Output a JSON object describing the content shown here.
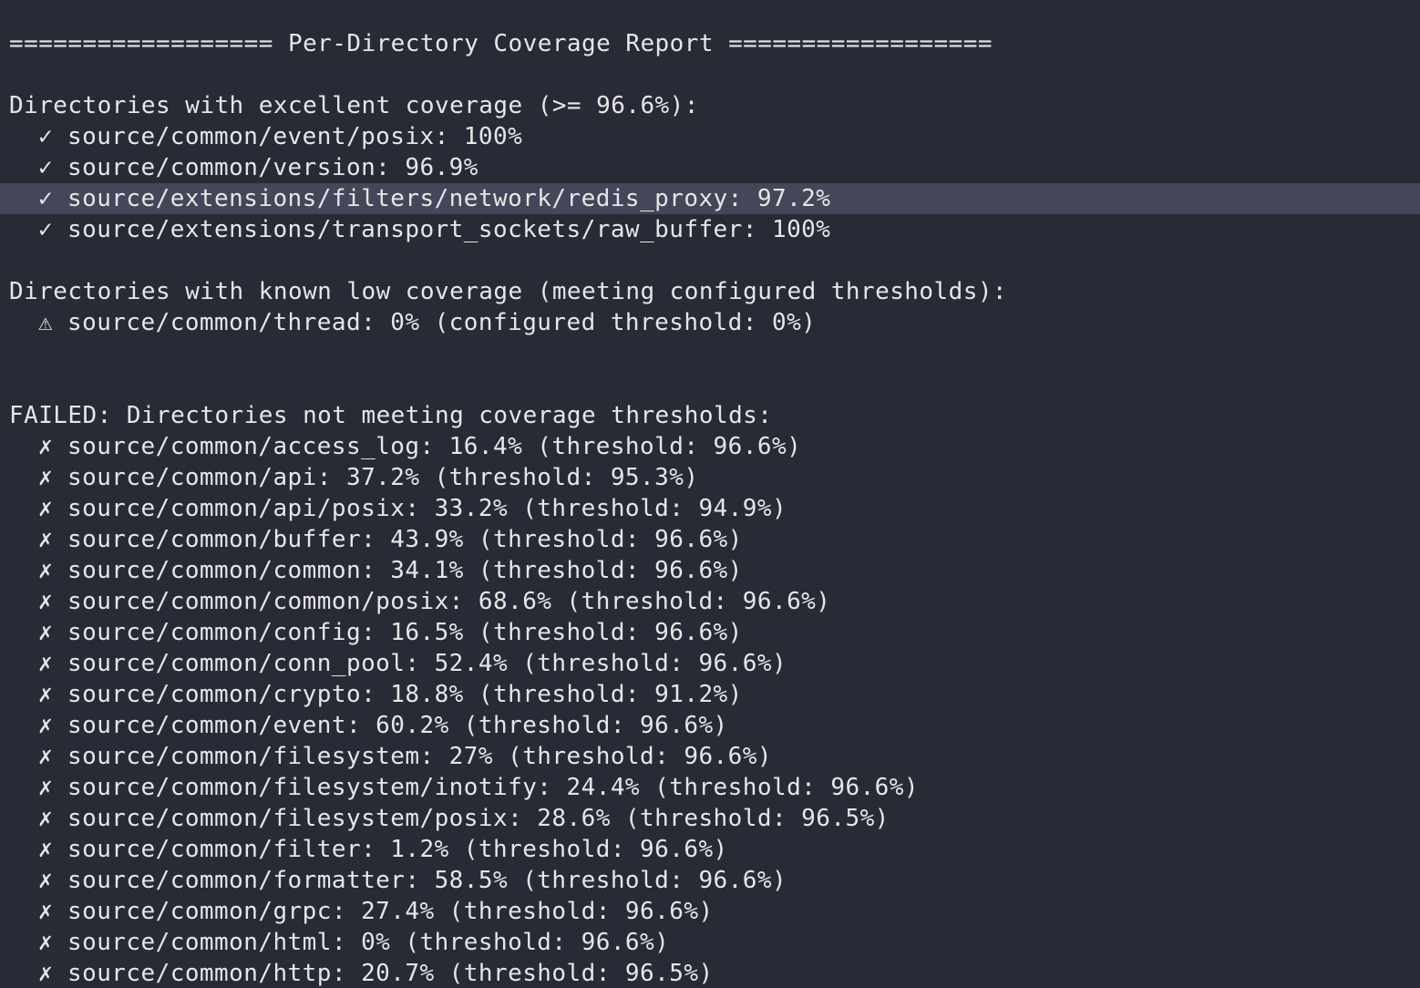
{
  "report": {
    "title": "================== Per-Directory Coverage Report ==================",
    "excellent": {
      "heading": "Directories with excellent coverage (>= 96.6%):",
      "mark": "✓",
      "items": [
        "source/common/event/posix: 100%",
        "source/common/version: 96.9%",
        "source/extensions/filters/network/redis_proxy: 97.2%",
        "source/extensions/transport_sockets/raw_buffer: 100%"
      ]
    },
    "known_low": {
      "heading": "Directories with known low coverage (meeting configured thresholds):",
      "mark": "⚠",
      "items": [
        "source/common/thread: 0% (configured threshold: 0%)"
      ]
    },
    "failed": {
      "heading": "FAILED: Directories not meeting coverage thresholds:",
      "mark": "✗",
      "items": [
        "source/common/access_log: 16.4% (threshold: 96.6%)",
        "source/common/api: 37.2% (threshold: 95.3%)",
        "source/common/api/posix: 33.2% (threshold: 94.9%)",
        "source/common/buffer: 43.9% (threshold: 96.6%)",
        "source/common/common: 34.1% (threshold: 96.6%)",
        "source/common/common/posix: 68.6% (threshold: 96.6%)",
        "source/common/config: 16.5% (threshold: 96.6%)",
        "source/common/conn_pool: 52.4% (threshold: 96.6%)",
        "source/common/crypto: 18.8% (threshold: 91.2%)",
        "source/common/event: 60.2% (threshold: 96.6%)",
        "source/common/filesystem: 27% (threshold: 96.6%)",
        "source/common/filesystem/inotify: 24.4% (threshold: 96.6%)",
        "source/common/filesystem/posix: 28.6% (threshold: 96.5%)",
        "source/common/filter: 1.2% (threshold: 96.6%)",
        "source/common/formatter: 58.5% (threshold: 96.6%)",
        "source/common/grpc: 27.4% (threshold: 96.6%)",
        "source/common/html: 0% (threshold: 96.6%)",
        "source/common/http: 20.7% (threshold: 96.5%)"
      ]
    }
  },
  "colors": {
    "background": "#282a36",
    "foreground": "#e6e6e6",
    "selection": "#44475a"
  }
}
